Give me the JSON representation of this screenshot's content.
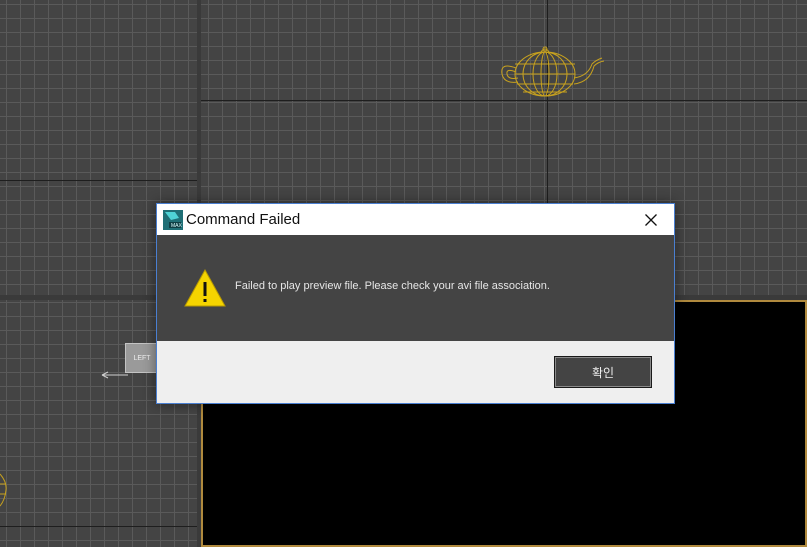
{
  "dialog": {
    "title": "Command Failed",
    "message": "Failed to play preview file. Please check your avi file association.",
    "ok_label": "확인",
    "app_icon": "3ds-max-icon",
    "warning_icon": "warning-icon",
    "close_icon": "close-icon"
  },
  "viewports": {
    "left_viewcube_label": "LEFT"
  },
  "colors": {
    "viewport_bg": "#444444",
    "wireframe": "#c8a21e",
    "dialog_border": "#4a7fd1",
    "warning_yellow": "#f5d400",
    "active_viewport_border": "#b08a3e"
  }
}
